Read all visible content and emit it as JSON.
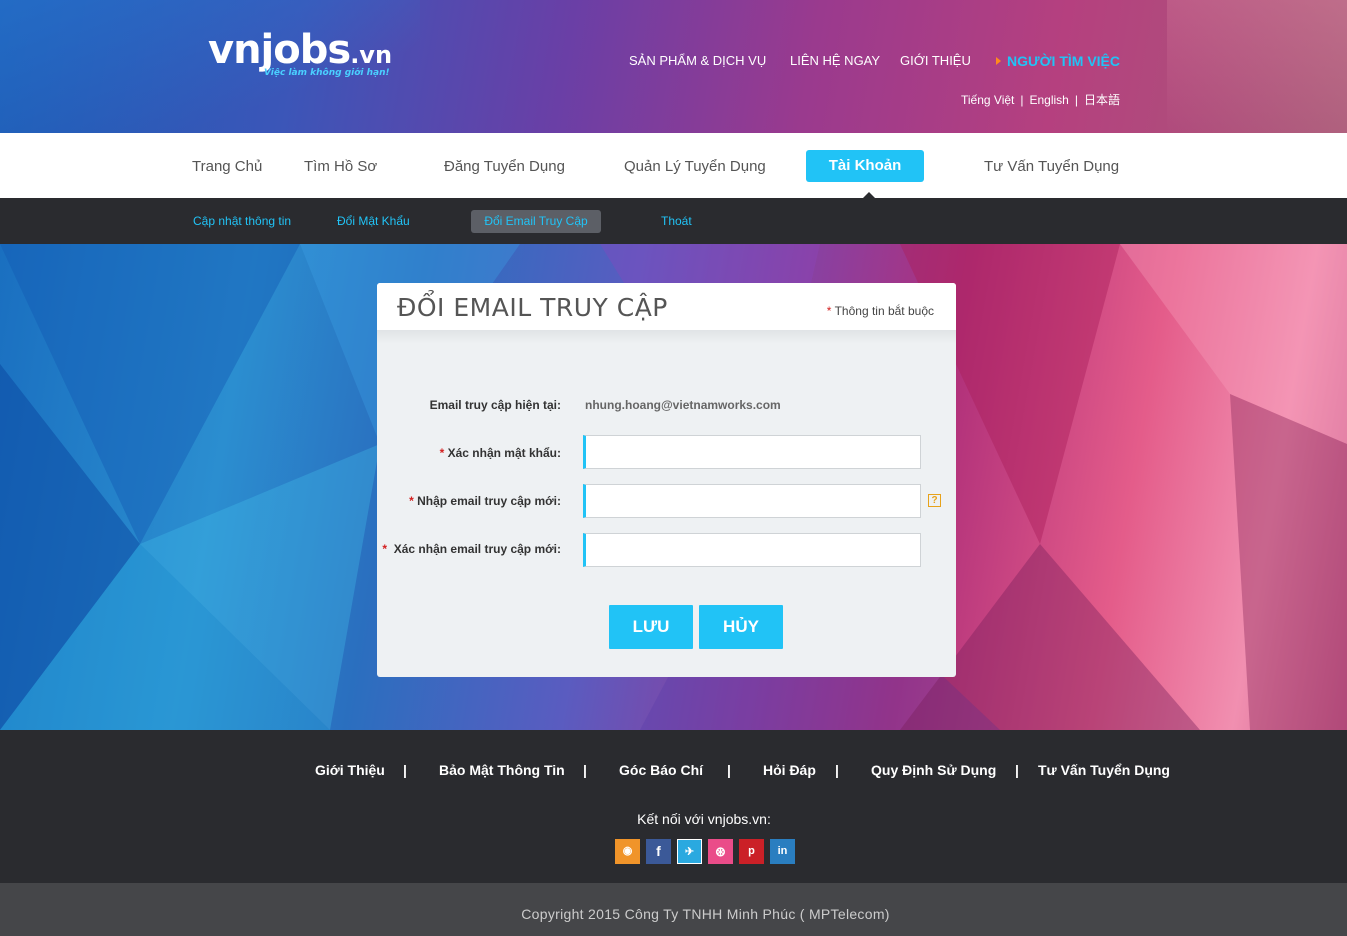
{
  "header": {
    "logo_main": "vnjobs",
    "logo_dot": ".vn",
    "logo_tagline": "Việc làm không giới hạn!",
    "top_nav": [
      {
        "label": "SẢN PHẨM & DỊCH VỤ"
      },
      {
        "label": "LIÊN HỆ NGAY"
      },
      {
        "label": "GIỚI THIỆU"
      },
      {
        "label": "NGƯỜI TÌM VIỆC"
      }
    ],
    "languages": [
      "Tiếng Việt",
      "English",
      "日本語"
    ],
    "lang_separator": "|"
  },
  "main_nav": {
    "items": [
      "Trang Chủ",
      "Tìm Hồ Sơ",
      "Đăng Tuyển Dụng",
      "Quản Lý Tuyển Dụng",
      "Tài Khoản",
      "Tư Vấn Tuyển Dụng"
    ],
    "active": "Tài Khoản"
  },
  "sub_nav": {
    "items": [
      "Cập nhật thông tin",
      "Đổi Mật Khẩu",
      "Đổi Email Truy Cập",
      "Thoát"
    ],
    "active": "Đổi Email Truy Cập"
  },
  "form": {
    "title": "ĐỔI EMAIL TRUY CẬP",
    "required_star": "*",
    "required_note": "Thông tin bắt buộc",
    "current_email_label": "Email truy cập hiện tại:",
    "current_email_value": "nhung.hoang@vietnamworks.com",
    "fields": [
      {
        "label": "Xác nhận mật khẩu:",
        "value": "",
        "required": true
      },
      {
        "label": "Nhập email truy cập mới:",
        "value": "",
        "required": true,
        "help_icon": "?"
      },
      {
        "label": "Xác nhận email truy cập mới:",
        "value": "",
        "required": true
      }
    ],
    "save_label": "LƯU",
    "cancel_label": "HỦY"
  },
  "footer": {
    "links": [
      "Giới Thiệu",
      "Bảo Mật Thông Tin",
      "Góc Báo Chí",
      "Hỏi Đáp",
      "Quy Định Sử Dụng",
      "Tư Vấn Tuyển Dụng"
    ],
    "separator": "|",
    "connect_text": "Kết nối với vnjobs.vn:",
    "social": [
      {
        "name": "rss-icon",
        "color": "#f0942a",
        "glyph": "◉"
      },
      {
        "name": "facebook-icon",
        "color": "#3b5998",
        "glyph": "f"
      },
      {
        "name": "twitter-icon",
        "color": "#2aa9e0",
        "glyph": "✈"
      },
      {
        "name": "dribbble-icon",
        "color": "#ea4c89",
        "glyph": "⊛"
      },
      {
        "name": "pinterest-icon",
        "color": "#cb2027",
        "glyph": "p"
      },
      {
        "name": "linkedin-icon",
        "color": "#2a7ec0",
        "glyph": "in"
      }
    ],
    "copyright": "Copyright 2015 Công Ty TNHH Minh Phúc ( MPTelecom)"
  },
  "colors": {
    "accent": "#21c3f6",
    "dark": "#2a2b2f",
    "required": "#d32020",
    "orange": "#ff8a1d"
  }
}
